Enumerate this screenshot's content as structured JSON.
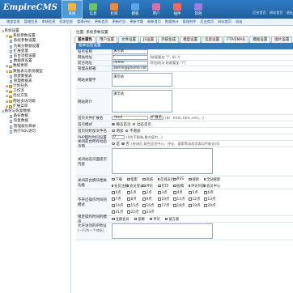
{
  "logo": "EmpireCMS",
  "topnav": [
    {
      "label": "系统",
      "active": true
    },
    {
      "label": "信息",
      "active": false
    },
    {
      "label": "栏目",
      "active": false
    },
    {
      "label": "模板",
      "active": false
    },
    {
      "label": "用户",
      "active": false
    },
    {
      "label": "插件",
      "active": false
    },
    {
      "label": "其他",
      "active": false
    }
  ],
  "toplinks": [
    "后台首页",
    "网站首页",
    "退出"
  ],
  "subnav": [
    "增加信息",
    "管理信息",
    "审核信息",
    "签发信息",
    "管理评论",
    "更新首页",
    "更新栏目",
    "更新专题",
    "刷新首页",
    "数据统计",
    "管理附件",
    "后台首页",
    "网站首页",
    "退出"
  ],
  "sidebar": [
    {
      "indent": 0,
      "label": "系统设置",
      "icon": "minus"
    },
    {
      "indent": 1,
      "label": "系统参数设置",
      "icon": "folder-open"
    },
    {
      "indent": 2,
      "label": "系统参数设置",
      "icon": "page"
    },
    {
      "indent": 2,
      "label": "负载分数据设置",
      "icon": "page"
    },
    {
      "indent": 2,
      "label": "扩展变量",
      "icon": "page"
    },
    {
      "indent": 2,
      "label": "前台功能设置",
      "icon": "page"
    },
    {
      "indent": 2,
      "label": "数据库设置",
      "icon": "page"
    },
    {
      "indent": 1,
      "label": "数据更新",
      "icon": "folder"
    },
    {
      "indent": 1,
      "label": "数据表与系统模型",
      "icon": "folder-open"
    },
    {
      "indent": 2,
      "label": "新建数据表",
      "icon": "page"
    },
    {
      "indent": 2,
      "label": "管理数据表",
      "icon": "page"
    },
    {
      "indent": 1,
      "label": "计划任务",
      "icon": "folder"
    },
    {
      "indent": 1,
      "label": "工作流",
      "icon": "folder"
    },
    {
      "indent": 1,
      "label": "优化方案",
      "icon": "folder"
    },
    {
      "indent": 1,
      "label": "网站多访问端",
      "icon": "folder"
    },
    {
      "indent": 1,
      "label": "扩展菜单",
      "icon": "folder"
    },
    {
      "indent": 0,
      "label": "备份与恢复数据",
      "icon": "minus"
    },
    {
      "indent": 2,
      "label": "备份数据",
      "icon": "page"
    },
    {
      "indent": 2,
      "label": "恢复数据",
      "icon": "page"
    },
    {
      "indent": 2,
      "label": "管理备份目录",
      "icon": "page"
    },
    {
      "indent": 2,
      "label": "执行SQL语句",
      "icon": "page"
    }
  ],
  "breadcrumb": "位置: 系统参数设置",
  "tabs": [
    "基本属性",
    "用户设置",
    "文件设置",
    "JS设置",
    "外链生成",
    "模型设置",
    "信息设置",
    "FTP/EMAIL",
    "模板设置",
    "图片设置"
  ],
  "section_title": "基本信息设置",
  "form": {
    "site_name": {
      "label": "站点名称",
      "value": "演示站"
    },
    "site_url": {
      "label": "网站地址",
      "value": "/",
      "note": "(结尾要加 \"/\", 如: /)"
    },
    "news_url": {
      "label": "前台地址",
      "value": "/d/file/",
      "note": "(附加地址 结尾要加 \"/\")"
    },
    "admin_email": {
      "label": "管理员邮箱",
      "value": "admin@phome.net"
    },
    "keywords": {
      "label": "网站关键字",
      "value": "演示站"
    },
    "description": {
      "label": "网站简介",
      "value": "演示站"
    },
    "index_file": {
      "label": "首页文件扩展名",
      "value": ".html",
      "select": "扩展名",
      "note": "(如: .html,.htm,.xml,...)"
    },
    "index_mode": {
      "label": "首页模式",
      "opts": [
        "静态首页",
        "动态首页"
      ],
      "sel": 0
    },
    "php_ext": {
      "label": "首页同附加文件名",
      "opts": [
        "增加",
        "不增加"
      ],
      "sel": 1
    },
    "php_count": {
      "label": "PHP超时时间设置",
      "value": "0",
      "note": "(0为不限制,最大值为...)"
    },
    "close_site": {
      "label": "关闭前台所有动态页面",
      "opts": [
        "是",
        "否"
      ],
      "sel": 1,
      "note": "(关闭后,前台会员中心、评论、搜索等动态页面均不能访问)"
    },
    "close_msg": {
      "label": "关闭动态页面提示内容"
    },
    "close_modules": {
      "label": "关闭前台模块相关功能",
      "items": [
        "下载",
        "电影",
        "商城",
        "在线支付",
        "RSS",
        "搜索",
        "全站搜索",
        "会员注册",
        "会员登录",
        "评论",
        "打印",
        "投稿",
        "评论列表",
        "会员中心"
      ]
    },
    "refresh_modes": {
      "label": "不开启操作时间的模式",
      "items": [
        "0点",
        "1点",
        "2点",
        "3点",
        "4点",
        "5点",
        "6点",
        "7点",
        "8点",
        "9点",
        "10点",
        "11点",
        "12点",
        "13点",
        "14点",
        "15点",
        "16点",
        "17点",
        "18点",
        "19点",
        "20点",
        "21点",
        "22点",
        "23点"
      ]
    },
    "time_limit": {
      "label": "限定操作时间的模块",
      "items": [
        "注册会员",
        "投稿",
        "评论",
        "留言板"
      ]
    },
    "ip_limit": {
      "label": "允许访问的IP地址",
      "note": "(一行为一个地址)"
    }
  }
}
